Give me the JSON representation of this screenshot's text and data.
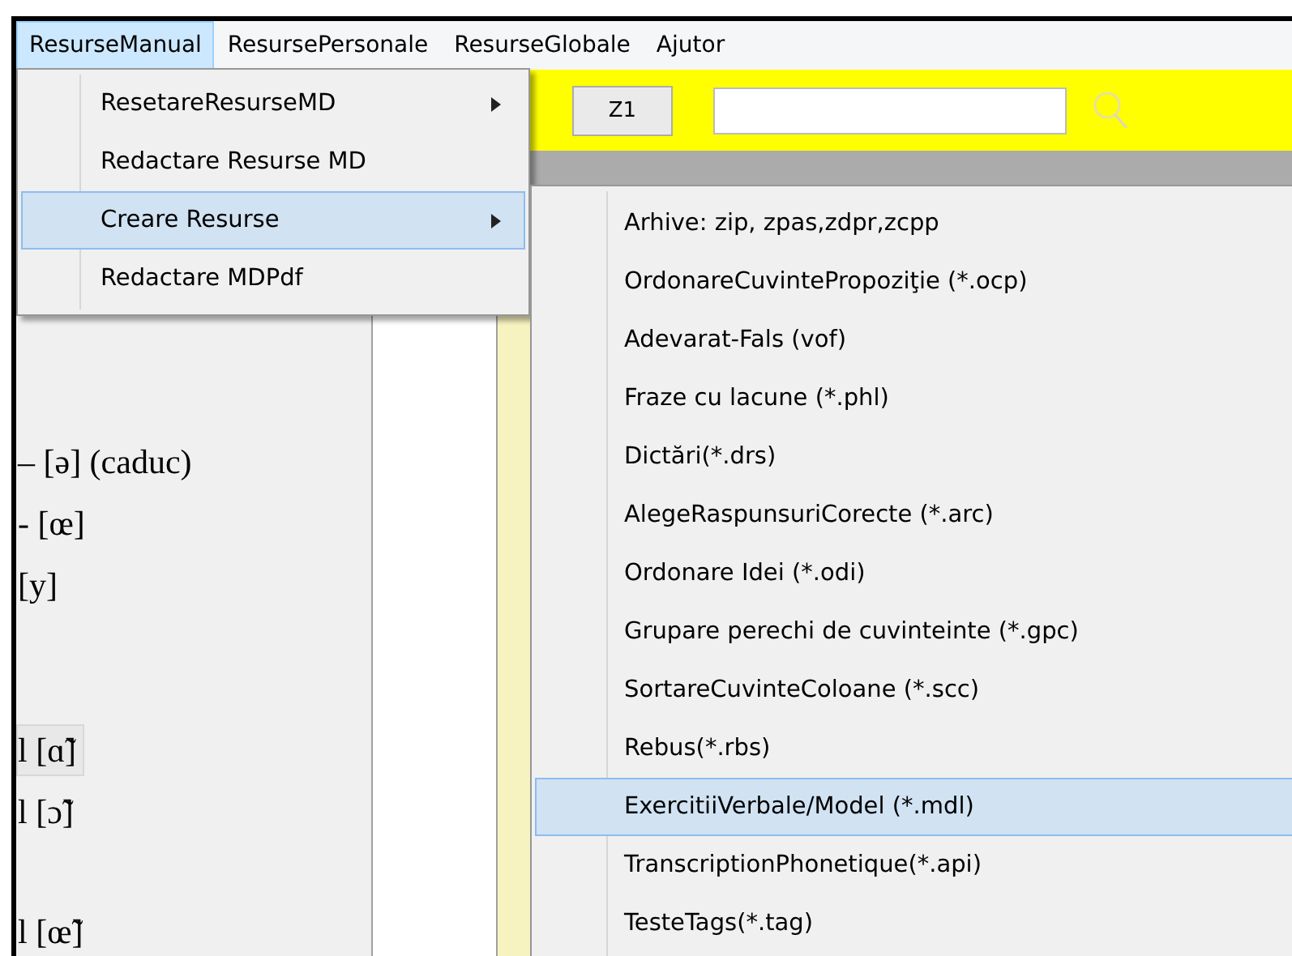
{
  "menubar": [
    {
      "label": "ResurseManual",
      "selected": true
    },
    {
      "label": "ResursePersonale",
      "selected": false
    },
    {
      "label": "ResurseGlobale",
      "selected": false
    },
    {
      "label": "Ajutor",
      "selected": false
    }
  ],
  "toolbar": {
    "button": "Z1"
  },
  "phonetics": [
    {
      "text": "– [ə] (caduc)",
      "boxed": false
    },
    {
      "text": "- [œ]",
      "boxed": false
    },
    {
      "text": "[y]",
      "boxed": false
    },
    {
      "text": "l [ɑ̃]",
      "boxed": true
    },
    {
      "text": "l [ɔ̃]",
      "boxed": false
    },
    {
      "text": "l [œ̃]",
      "boxed": false
    }
  ],
  "menu": [
    {
      "label": "ResetareResurseMD",
      "submenu": true,
      "selected": false
    },
    {
      "label": "Redactare Resurse MD",
      "submenu": false,
      "selected": false
    },
    {
      "label": "Creare Resurse",
      "submenu": true,
      "selected": true
    },
    {
      "label": "Redactare MDPdf",
      "submenu": false,
      "selected": false
    }
  ],
  "submenu": [
    {
      "label": "Arhive: zip, zpas,zdpr,zcpp",
      "selected": false
    },
    {
      "label": "OrdonareCuvintePropoziţie (*.ocp)",
      "selected": false
    },
    {
      "label": "Adevarat-Fals (vof)",
      "selected": false
    },
    {
      "label": "Fraze cu lacune (*.phl)",
      "selected": false
    },
    {
      "label": "Dictări(*.drs)",
      "selected": false
    },
    {
      "label": "AlegeRaspunsuriCorecte (*.arc)",
      "selected": false
    },
    {
      "label": "Ordonare Idei (*.odi)",
      "selected": false
    },
    {
      "label": "Grupare perechi de cuvinteinte  (*.gpc)",
      "selected": false
    },
    {
      "label": "SortareCuvinteColoane (*.scc)",
      "selected": false
    },
    {
      "label": "Rebus(*.rbs)",
      "selected": false
    },
    {
      "label": "ExercitiiVerbale/Model (*.mdl)",
      "selected": true
    },
    {
      "label": "TranscriptionPhonetique(*.api)",
      "selected": false
    },
    {
      "label": "TesteTags(*.tag)",
      "selected": false
    }
  ]
}
